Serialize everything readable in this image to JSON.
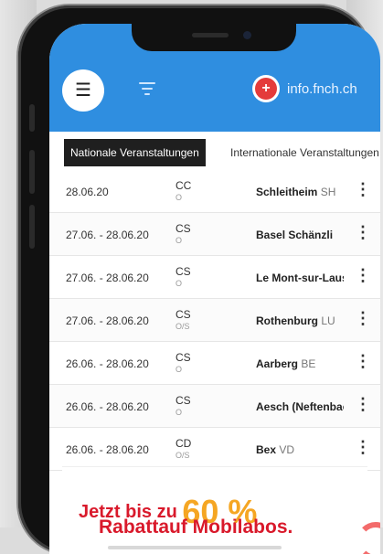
{
  "header": {
    "menu_icon": "menu-icon",
    "filter_icon": "filter-icon",
    "logo_icon": "swiss-cross-logo",
    "logo_text": "info.fnch.ch",
    "accent_color": "#2f8ee0"
  },
  "tabs": [
    {
      "label": "Nationale Veranstaltungen",
      "active": true
    },
    {
      "label": "Internationale Veranstaltungen",
      "active": false
    }
  ],
  "events": [
    {
      "date": "28.06.20",
      "discipline": "CC",
      "sub": "O",
      "place": "Schleitheim",
      "canton": "SH"
    },
    {
      "date": "27.06. - 28.06.20",
      "discipline": "CS",
      "sub": "O",
      "place": "Basel Schänzli",
      "canton": ""
    },
    {
      "date": "27.06. - 28.06.20",
      "discipline": "CS",
      "sub": "O",
      "place": "Le Mont-sur-Lausanne",
      "canton": ""
    },
    {
      "date": "27.06. - 28.06.20",
      "discipline": "CS",
      "sub": "O/S",
      "place": "Rothenburg",
      "canton": "LU"
    },
    {
      "date": "26.06. - 28.06.20",
      "discipline": "CS",
      "sub": "O",
      "place": "Aarberg",
      "canton": "BE"
    },
    {
      "date": "26.06. - 28.06.20",
      "discipline": "CS",
      "sub": "O",
      "place": "Aesch (Neftenbach)",
      "canton": ""
    },
    {
      "date": "26.06. - 28.06.20",
      "discipline": "CD",
      "sub": "O/S",
      "place": "Bex",
      "canton": "VD"
    }
  ],
  "ad": {
    "line1_prefix": "Jetzt bis zu ",
    "line1_percent": "60 %",
    "line2": "Rabattauf Mobilabos."
  }
}
